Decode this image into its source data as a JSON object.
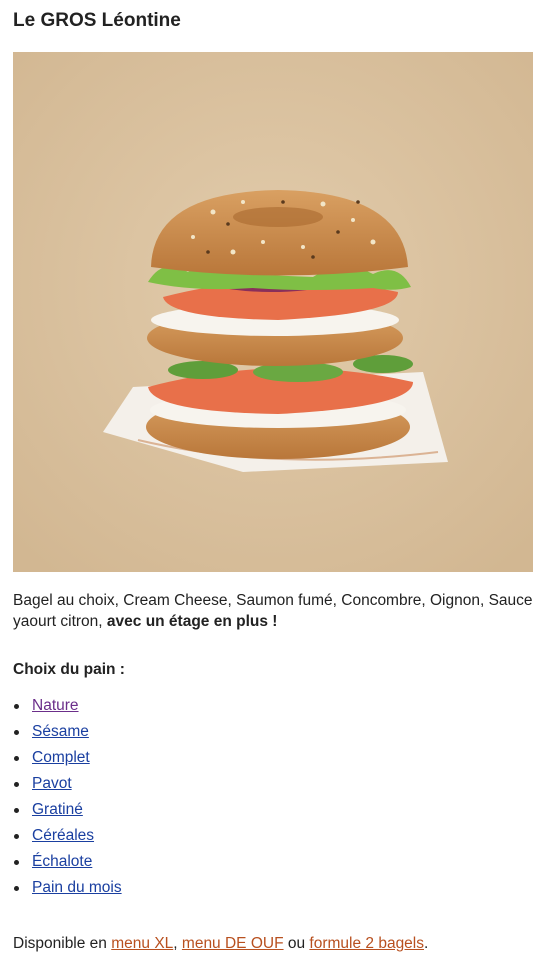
{
  "product": {
    "title": "Le GROS Léontine",
    "image_icon": "bagel-sandwich-image",
    "description_plain": "Bagel au choix, Cream Cheese, Saumon fumé, Concombre, Oignon, Sauce yaourt citron, ",
    "description_bold": "avec un étage en plus !"
  },
  "choices": {
    "title": "Choix du pain :",
    "items": [
      "Nature",
      "Sésame",
      "Complet",
      "Pavot",
      "Gratiné",
      "Céréales",
      "Échalote",
      "Pain du mois"
    ]
  },
  "availability": {
    "prefix": "Disponible en ",
    "link1": "menu XL",
    "sep1": ", ",
    "link2": "menu DE OUF",
    "sep2": " ou ",
    "link3": "formule 2 bagels",
    "suffix": "."
  },
  "colors": {
    "link": "#1a3fa0",
    "visited_link": "#6b2e8a",
    "menu_link": "#b8501f",
    "image_background": "#dcc4a3"
  }
}
